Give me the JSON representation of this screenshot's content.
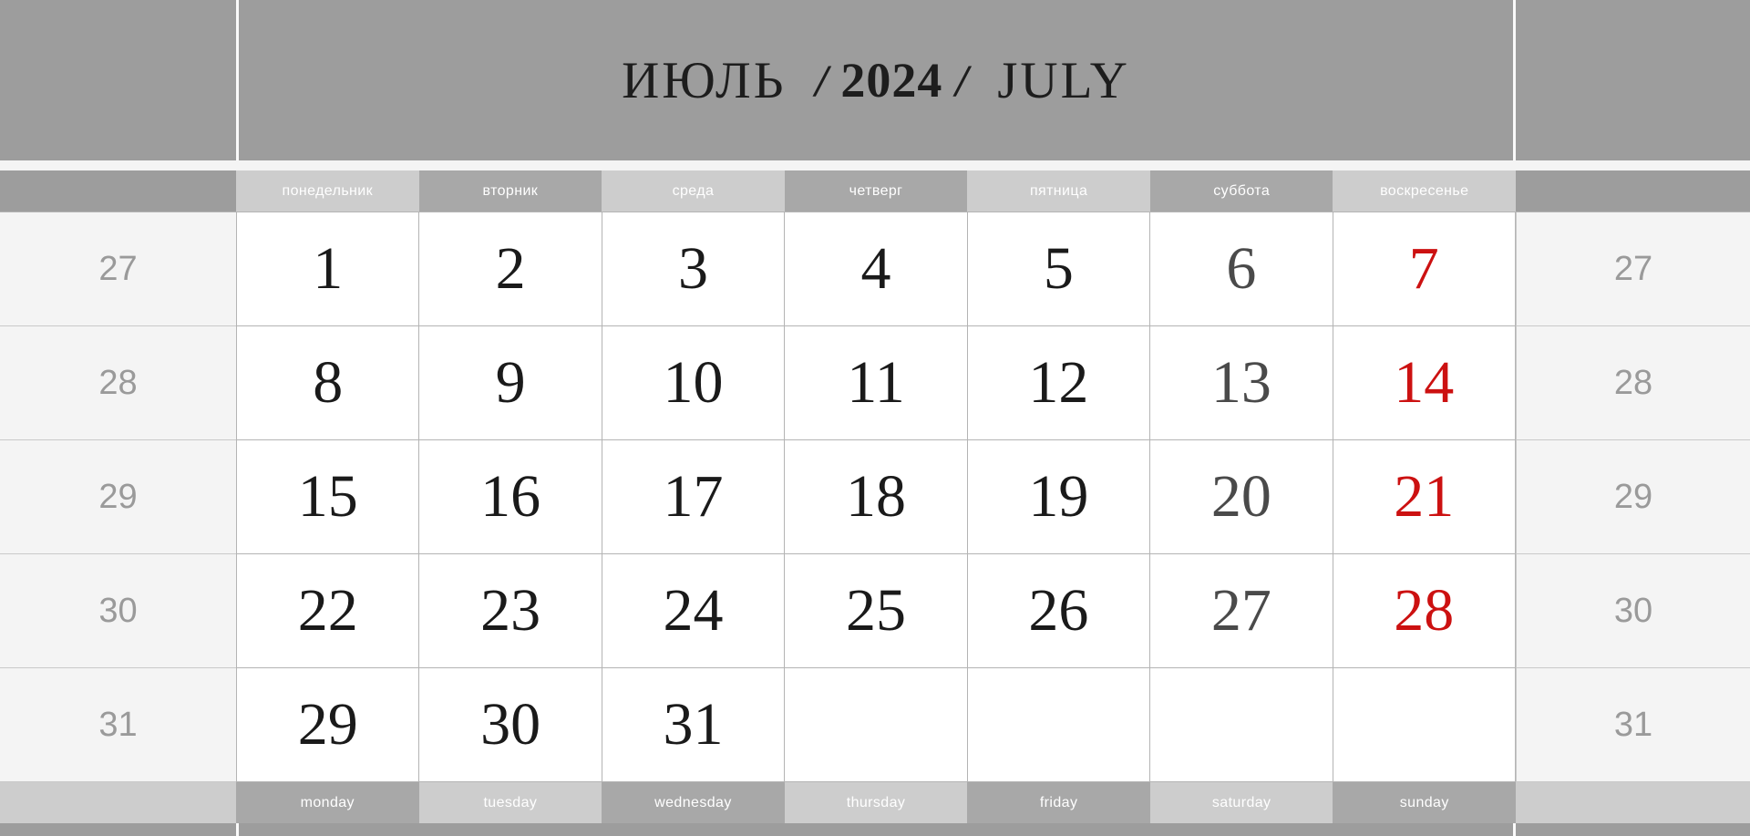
{
  "title": {
    "month_ru": "ИЮЛЬ",
    "slash_left": "/",
    "year": "2024",
    "slash_right": "/",
    "month_en": "JULY"
  },
  "weekdays_ru": [
    {
      "label": "понедельник",
      "tone": "lt"
    },
    {
      "label": "вторник",
      "tone": "dk"
    },
    {
      "label": "среда",
      "tone": "lt"
    },
    {
      "label": "четверг",
      "tone": "dk"
    },
    {
      "label": "пятница",
      "tone": "lt"
    },
    {
      "label": "суббота",
      "tone": "dk"
    },
    {
      "label": "воскресенье",
      "tone": "lt"
    }
  ],
  "weekdays_en": [
    {
      "label": "monday",
      "tone": "dk"
    },
    {
      "label": "tuesday",
      "tone": "lt"
    },
    {
      "label": "wednesday",
      "tone": "dk"
    },
    {
      "label": "thursday",
      "tone": "lt"
    },
    {
      "label": "friday",
      "tone": "dk"
    },
    {
      "label": "saturday",
      "tone": "lt"
    },
    {
      "label": "sunday",
      "tone": "dk"
    }
  ],
  "week_numbers": [
    "27",
    "28",
    "29",
    "30",
    "31"
  ],
  "weeks": [
    {
      "week_no": "27",
      "days": [
        "1",
        "2",
        "3",
        "4",
        "5",
        "6",
        "7"
      ]
    },
    {
      "week_no": "28",
      "days": [
        "8",
        "9",
        "10",
        "11",
        "12",
        "13",
        "14"
      ]
    },
    {
      "week_no": "29",
      "days": [
        "15",
        "16",
        "17",
        "18",
        "19",
        "20",
        "21"
      ]
    },
    {
      "week_no": "30",
      "days": [
        "22",
        "23",
        "24",
        "25",
        "26",
        "27",
        "28"
      ]
    },
    {
      "week_no": "31",
      "days": [
        "29",
        "30",
        "31",
        "",
        "",
        "",
        ""
      ]
    }
  ],
  "colors": {
    "frame_gray": "#9d9d9d",
    "header_light": "#cdcdcd",
    "header_dark": "#a8a8a8",
    "week_col_bg": "#f4f4f4",
    "week_no_text": "#9a9a9a",
    "day_text": "#1a1a1a",
    "saturday_text": "#4a4a4a",
    "sunday_red": "#cc1111",
    "cell_border": "#b4b4b4"
  }
}
